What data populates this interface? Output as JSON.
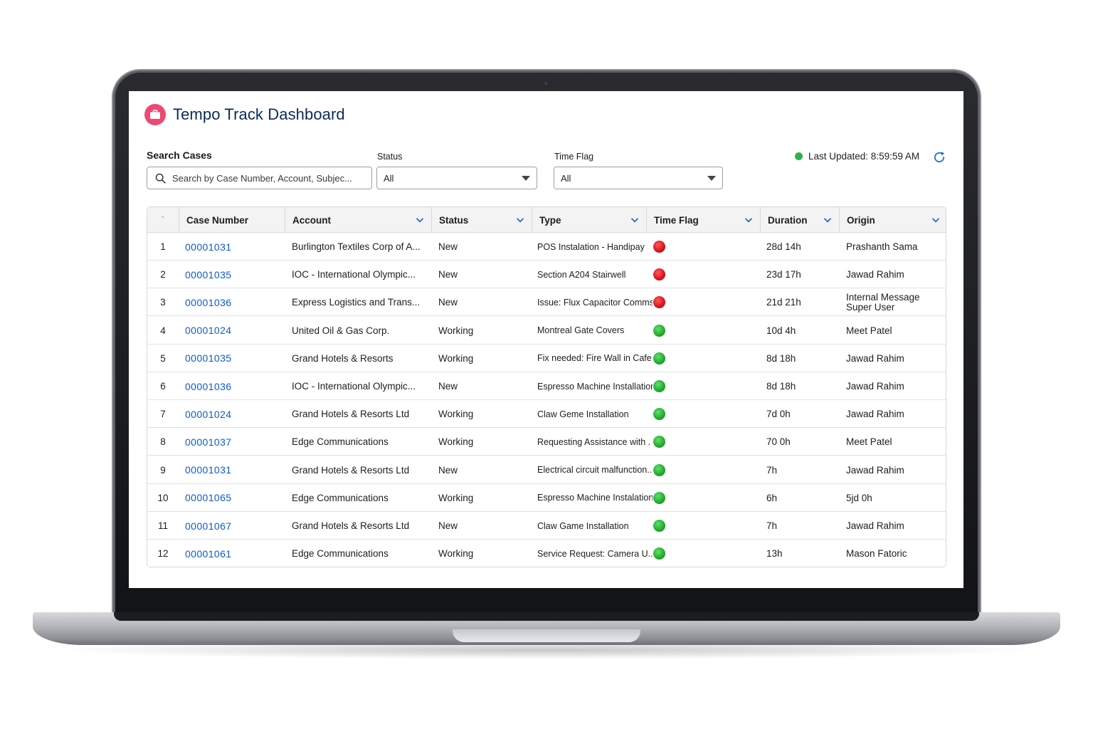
{
  "app": {
    "title": "Tempo Track Dashboard",
    "accent_color": "#ea4a73",
    "icon": "briefcase-icon"
  },
  "filters": {
    "search_label": "Search Cases",
    "search_placeholder": "Search by Case Number, Account, Subjec...",
    "status_label": "Status",
    "status_value": "All",
    "timeflag_label": "Time Flag",
    "timeflag_value": "All"
  },
  "status_bar": {
    "last_updated": "Last Updated: 8:59:59 AM",
    "indicator_color": "#2eb348"
  },
  "table": {
    "columns": {
      "index": "`",
      "case_number": "Case Number",
      "account": "Account",
      "status": "Status",
      "type": "Type",
      "time_flag": "Time Flag",
      "duration": "Duration",
      "origin": "Origin"
    },
    "rows": [
      {
        "n": "1",
        "case": "00001031",
        "account": "Burlington Textiles Corp of A...",
        "status": "New",
        "type": "POS Instalation - Handipay",
        "flag": "red",
        "duration": "28d 14h",
        "origin": "Prashanth Sama",
        "origin2": ""
      },
      {
        "n": "2",
        "case": "00001035",
        "account": "IOC - International Olympic...",
        "status": "New",
        "type": "Section A204 Stairwell",
        "flag": "red",
        "duration": "23d 17h",
        "origin": "Jawad Rahim",
        "origin2": ""
      },
      {
        "n": "3",
        "case": "00001036",
        "account": "Express Logistics and Trans...",
        "status": "New",
        "type": "Issue: Flux Capacitor Comms",
        "flag": "red",
        "duration": "21d 21h",
        "origin": "Internal Message",
        "origin2": "Super User"
      },
      {
        "n": "4",
        "case": "00001024",
        "account": "United Oil & Gas Corp.",
        "status": "Working",
        "type": "Montreal Gate Covers",
        "flag": "green",
        "duration": "10d 4h",
        "origin": "Meet Patel",
        "origin2": ""
      },
      {
        "n": "5",
        "case": "00001035",
        "account": "Grand Hotels & Resorts",
        "status": "Working",
        "type": "Fix needed: Fire Wall in Cafe",
        "flag": "green",
        "duration": "8d 18h",
        "origin": "Jawad Rahim",
        "origin2": ""
      },
      {
        "n": "6",
        "case": "00001036",
        "account": "IOC - International Olympic...",
        "status": "New",
        "type": "Espresso Machine Installation",
        "flag": "green",
        "duration": "8d 18h",
        "origin": "Jawad Rahim",
        "origin2": ""
      },
      {
        "n": "7",
        "case": "00001024",
        "account": "Grand Hotels & Resorts Ltd",
        "status": "Working",
        "type": "Claw Geme Installation",
        "flag": "green",
        "duration": "7d 0h",
        "origin": "Jawad Rahim",
        "origin2": ""
      },
      {
        "n": "8",
        "case": "00001037",
        "account": "Edge Communications",
        "status": "Working",
        "type": "Requesting Assistance with .",
        "flag": "green",
        "duration": "70 0h",
        "origin": "Meet Patel",
        "origin2": ""
      },
      {
        "n": "9",
        "case": "00001031",
        "account": "Grand Hotels & Resorts Ltd",
        "status": "New",
        "type": "Electrical circuit malfunction...",
        "flag": "green",
        "duration": "7h",
        "origin": "Jawad Rahim",
        "origin2": ""
      },
      {
        "n": "10",
        "case": "00001065",
        "account": "Edge Communications",
        "status": "Working",
        "type": "Espresso Machine Instalation",
        "flag": "green",
        "duration": "6h",
        "origin": "5jd 0h",
        "origin2": ""
      },
      {
        "n": "11",
        "case": "00001067",
        "account": "Grand Hotels & Resorts Ltd",
        "status": "New",
        "type": "Claw Game Installation",
        "flag": "green",
        "duration": "7h",
        "origin": "Jawad Rahim",
        "origin2": ""
      },
      {
        "n": "12",
        "case": "00001061",
        "account": "Edge Communications",
        "status": "Working",
        "type": "Service Request: Camera U..",
        "flag": "green",
        "duration": "13h",
        "origin": "Mason Fatoric",
        "origin2": ""
      }
    ]
  }
}
